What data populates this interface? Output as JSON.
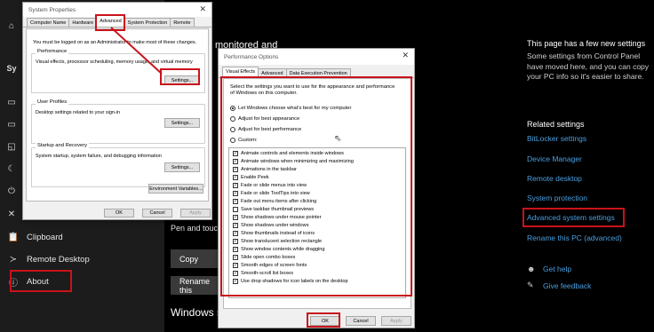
{
  "settings_nav": [
    {
      "label": "Clipboard",
      "icon": "clipboard-icon"
    },
    {
      "label": "Remote Desktop",
      "icon": "remote-desktop-icon"
    },
    {
      "label": "About",
      "icon": "info-icon"
    }
  ],
  "mid": {
    "heading_fragment": "monitored and",
    "pen_touch": "Pen and touch",
    "copy_button": "Copy",
    "rename_button": "Rename this",
    "windows_heading": "Windows s"
  },
  "right_pane": {
    "title": "This page has a few new settings",
    "description": "Some settings from Control Panel have moved here, and you can copy your PC info so it's easier to share.",
    "related_title": "Related settings",
    "links": [
      "BitLocker settings",
      "Device Manager",
      "Remote desktop",
      "System protection",
      "Advanced system settings",
      "Rename this PC (advanced)"
    ],
    "help": [
      {
        "label": "Get help",
        "icon": "help-icon"
      },
      {
        "label": "Give feedback",
        "icon": "feedback-icon"
      }
    ]
  },
  "system_properties": {
    "title": "System Properties",
    "tabs": [
      "Computer Name",
      "Hardware",
      "Advanced",
      "System Protection",
      "Remote"
    ],
    "admin_note": "You must be logged on as an Administrator to make most of these changes.",
    "performance": {
      "label": "Performance",
      "desc": "Visual effects, processor scheduling, memory usage, and virtual memory",
      "button": "Settings..."
    },
    "user_profiles": {
      "label": "User Profiles",
      "desc": "Desktop settings related to your sign-in",
      "button": "Settings..."
    },
    "startup": {
      "label": "Startup and Recovery",
      "desc": "System startup, system failure, and debugging information",
      "button": "Settings..."
    },
    "env_button": "Environment Variables...",
    "ok": "OK",
    "cancel": "Cancel",
    "apply": "Apply"
  },
  "performance_options": {
    "title": "Performance Options",
    "tabs": [
      "Visual Effects",
      "Advanced",
      "Data Execution Prevention"
    ],
    "intro": "Select the settings you want to use for the appearance and performance of Windows on this computer.",
    "radios": [
      {
        "label": "Let Windows choose what's best for my computer",
        "selected": true
      },
      {
        "label": "Adjust for best appearance",
        "selected": false
      },
      {
        "label": "Adjust for best performance",
        "selected": false
      },
      {
        "label": "Custom:",
        "selected": false
      }
    ],
    "checks": [
      "Animate controls and elements inside windows",
      "Animate windows when minimizing and maximizing",
      "Animations in the taskbar",
      "Enable Peek",
      "Fade or slide menus into view",
      "Fade or slide ToolTips into view",
      "Fade out menu items after clicking",
      "Save taskbar thumbnail previews",
      "Show shadows under mouse pointer",
      "Show shadows under windows",
      "Show thumbnails instead of icons",
      "Show translucent selection rectangle",
      "Show window contents while dragging",
      "Slide open combo boxes",
      "Smooth edges of screen fonts",
      "Smooth-scroll list boxes",
      "Use drop shadows for icon labels on the desktop"
    ],
    "ok": "OK",
    "cancel": "Cancel",
    "apply": "Apply"
  },
  "colors": {
    "highlight": "#c9131b",
    "link": "#4a9fe0"
  }
}
